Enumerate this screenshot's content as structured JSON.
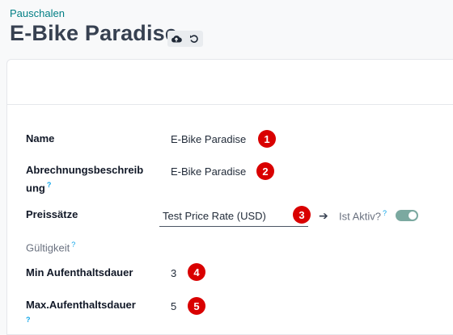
{
  "header": {
    "breadcrumb": "Pauschalen",
    "title": "E-Bike Paradise"
  },
  "icons": {
    "save": "cloud-upload-icon",
    "discard": "undo-icon"
  },
  "form": {
    "name": {
      "label": "Name",
      "value": "E-Bike Paradise",
      "badge": "1"
    },
    "description": {
      "label_line1": "Abrechnungsbeschreib",
      "label_line2": "ung",
      "help": "?",
      "value": "E-Bike Paradise",
      "badge": "2"
    },
    "price_rates": {
      "label": "Preissätze",
      "value": "Test Price Rate (USD)",
      "badge": "3",
      "arrow": "➔",
      "active_label": "Ist Aktiv?",
      "active_help": "?",
      "active": true
    },
    "validity": {
      "label": "Gültigkeit",
      "help": "?"
    },
    "min_stay": {
      "label": "Min Aufenthaltsdauer",
      "value": "3",
      "badge": "4"
    },
    "max_stay": {
      "label": "Max.Aufenthaltsdauer",
      "help": "?",
      "value": "5",
      "badge": "5"
    }
  },
  "colors": {
    "accent": "#017e84",
    "badge": "#d90000",
    "help": "#0ea5e9",
    "toggle": "#7ba9a0"
  }
}
